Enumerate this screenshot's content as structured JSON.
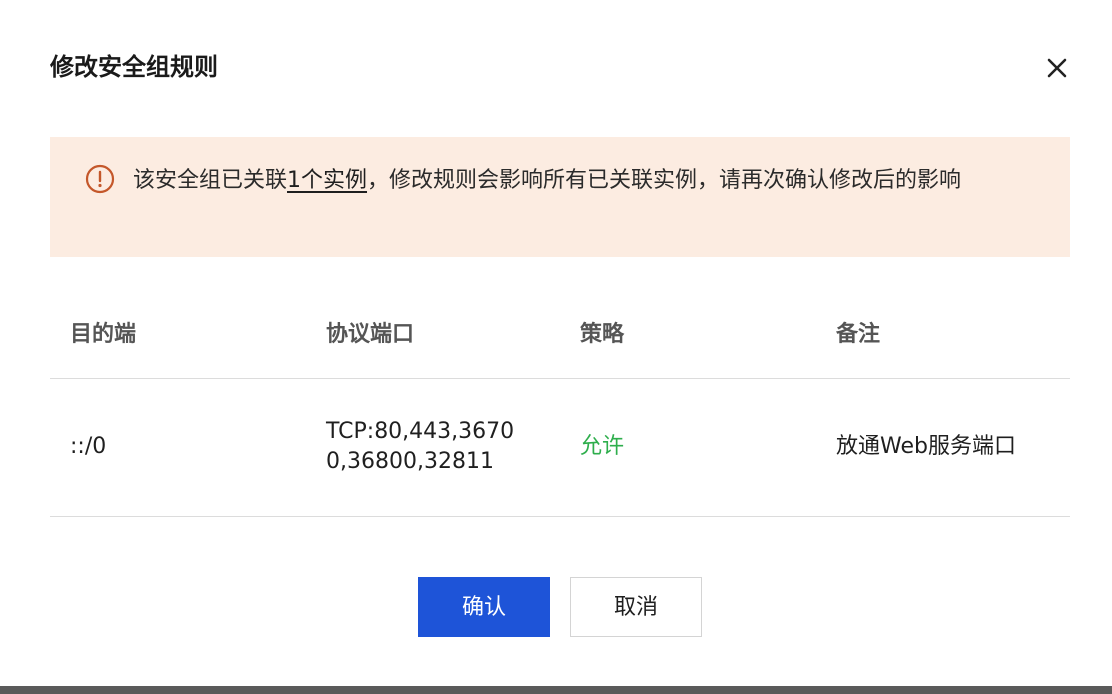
{
  "dialog": {
    "title": "修改安全组规则",
    "close_icon": "close-icon"
  },
  "alert": {
    "icon": "warning-circle-icon",
    "text_before": "该安全组已关联",
    "link_text": "1个实例",
    "text_after": "，修改规则会影响所有已关联实例，请再次确认修改后的影响",
    "accent_color": "#c4572a",
    "background_color": "#fcece1"
  },
  "table": {
    "headers": [
      "目的端",
      "协议端口",
      "策略",
      "备注"
    ],
    "rows": [
      {
        "destination": "::/0",
        "protocol_port": "TCP:80,443,36700,36800,32811",
        "policy": "允许",
        "note": "放通Web服务端口"
      }
    ],
    "allow_color": "#2eae4c"
  },
  "buttons": {
    "confirm": "确认",
    "cancel": "取消",
    "primary_color": "#1e54d8"
  }
}
